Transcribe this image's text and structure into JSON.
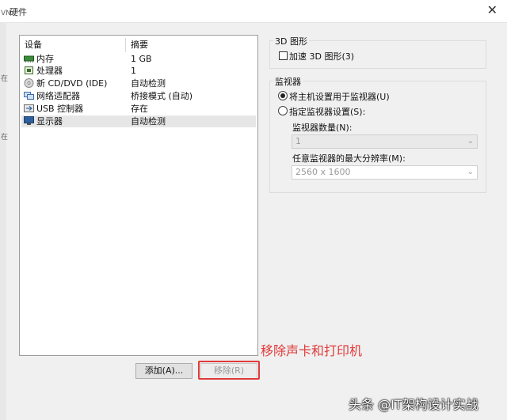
{
  "window": {
    "title": "硬件",
    "close_symbol": "✕"
  },
  "sidebar_marks": [
    "VN",
    "在",
    "在"
  ],
  "device_list": {
    "col_device": "设备",
    "col_summary": "摘要",
    "rows": [
      {
        "name": "内存",
        "summary": "1 GB",
        "icon": "memory-icon"
      },
      {
        "name": "处理器",
        "summary": "1",
        "icon": "processor-icon"
      },
      {
        "name": "新 CD/DVD (IDE)",
        "summary": "自动检测",
        "icon": "cd-dvd-icon"
      },
      {
        "name": "网络适配器",
        "summary": "桥接模式 (自动)",
        "icon": "network-adapter-icon"
      },
      {
        "name": "USB 控制器",
        "summary": "存在",
        "icon": "usb-controller-icon"
      },
      {
        "name": "显示器",
        "summary": "自动检测",
        "icon": "display-icon"
      }
    ]
  },
  "buttons": {
    "add": "添加(A)...",
    "remove": "移除(R)"
  },
  "annotation": "移除声卡和打印机",
  "group_3d": {
    "label": "3D 图形",
    "accelerate": "加速 3D 图形(3)"
  },
  "group_monitor": {
    "label": "监视器",
    "opt_host": "将主机设置用于监视器(U)",
    "opt_custom": "指定监视器设置(S):",
    "count_label": "监视器数量(N):",
    "count_value": "1",
    "maxres_label": "任意监视器的最大分辨率(M):",
    "maxres_value": "2560 x 1600"
  },
  "watermark": "头条 @IT架构设计实战",
  "colors": {
    "annotation_red": "#e03a3a"
  }
}
